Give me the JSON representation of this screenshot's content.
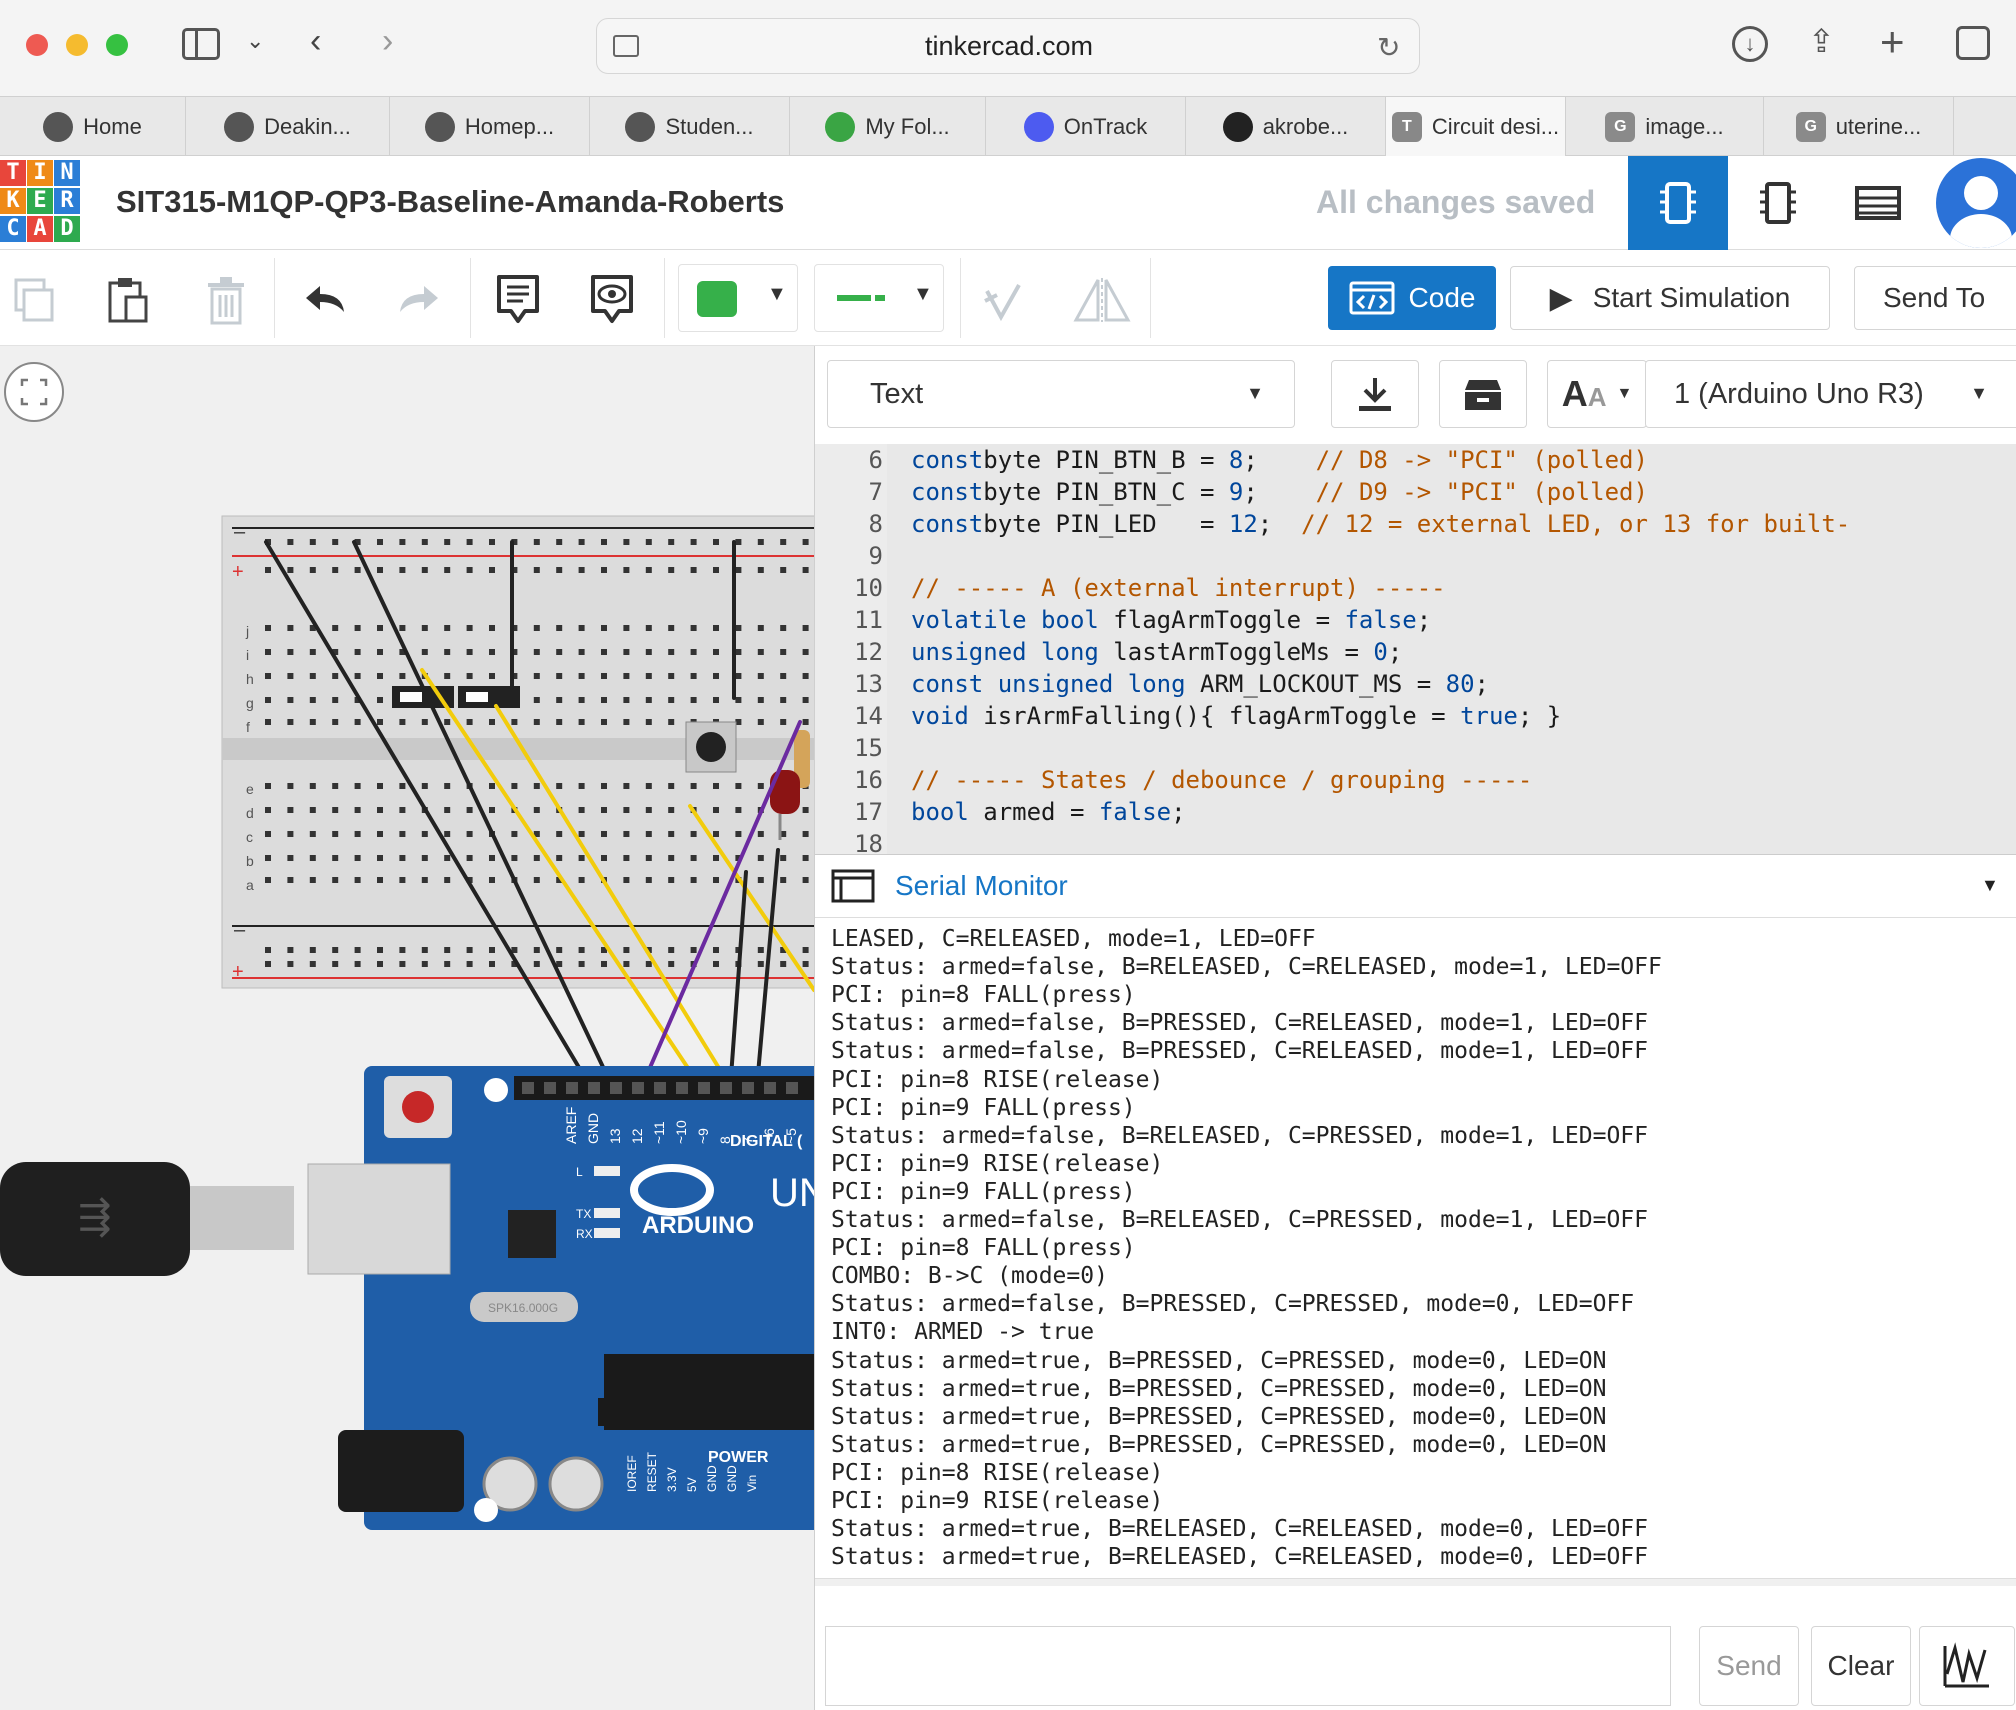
{
  "browser": {
    "url": "tinkercad.com",
    "tabs": [
      {
        "label": "Home",
        "icon": "brand-icon",
        "color": "#555555"
      },
      {
        "label": "Deakin...",
        "icon": "brand-icon",
        "color": "#555555"
      },
      {
        "label": "Homep...",
        "icon": "brand-icon",
        "color": "#555555"
      },
      {
        "label": "Studen...",
        "icon": "brand-icon",
        "color": "#555555"
      },
      {
        "label": "My Fol...",
        "icon": "folder-icon",
        "color": "#3aa544"
      },
      {
        "label": "OnTrack",
        "icon": "ontrack-icon",
        "color": "#4d5bf0"
      },
      {
        "label": "akrobe...",
        "icon": "github-icon",
        "color": "#222222"
      },
      {
        "label": "Circuit desi...",
        "icon": "letter-t-icon",
        "color": "#888888",
        "letter": "T"
      },
      {
        "label": "image...",
        "icon": "letter-g-icon",
        "color": "#8a8a8a",
        "letter": "G"
      },
      {
        "label": "uterine...",
        "icon": "letter-g-icon",
        "color": "#8a8a8a",
        "letter": "G"
      }
    ]
  },
  "app": {
    "logo_letters": [
      "T",
      "I",
      "N",
      "K",
      "E",
      "R",
      "C",
      "A",
      "D"
    ],
    "logo_colors": [
      "#e8463b",
      "#ef8a17",
      "#2b7ed6",
      "#ef8a17",
      "#2eaa4f",
      "#2b7ed6",
      "#2b7ed6",
      "#e8463b",
      "#2eaa4f"
    ],
    "project_title": "SIT315-M1QP-QP3-Baseline-Amanda-Roberts",
    "save_status": "All changes saved",
    "accent": "#1676c6"
  },
  "toolbar": {
    "code_label": "Code",
    "simulate_label": "Start Simulation",
    "send_to_label": "Send To",
    "fill_color": "#36b04a",
    "wire_color": "#36b04a"
  },
  "code_panel": {
    "mode_select": "Text",
    "board_select": "1 (Arduino Uno R3)",
    "lines": [
      {
        "n": "6",
        "segs": [
          [
            "kw",
            "const"
          ],
          [
            "",
            "byte PIN_BTN_B = "
          ],
          [
            "num",
            "8"
          ],
          [
            "",
            ";    "
          ],
          [
            "cm",
            "// D8 -> \"PCI\" (polled)"
          ]
        ]
      },
      {
        "n": "7",
        "segs": [
          [
            "kw",
            "const"
          ],
          [
            "",
            "byte PIN_BTN_C = "
          ],
          [
            "num",
            "9"
          ],
          [
            "",
            ";    "
          ],
          [
            "cm",
            "// D9 -> \"PCI\" (polled)"
          ]
        ]
      },
      {
        "n": "8",
        "segs": [
          [
            "kw",
            "const"
          ],
          [
            "",
            "byte PIN_LED   = "
          ],
          [
            "num",
            "12"
          ],
          [
            "",
            ";  "
          ],
          [
            "cm",
            "// 12 = external LED, or 13 for built-"
          ]
        ]
      },
      {
        "n": "9",
        "segs": []
      },
      {
        "n": "10",
        "segs": [
          [
            "cm",
            "// ----- A (external interrupt) -----"
          ]
        ]
      },
      {
        "n": "11",
        "segs": [
          [
            "kw",
            "volatile bool"
          ],
          [
            "",
            " flagArmToggle = "
          ],
          [
            "kw",
            "false"
          ],
          [
            "",
            ";"
          ]
        ]
      },
      {
        "n": "12",
        "segs": [
          [
            "kw",
            "unsigned long"
          ],
          [
            "",
            " lastArmToggleMs = "
          ],
          [
            "num",
            "0"
          ],
          [
            "",
            ";"
          ]
        ]
      },
      {
        "n": "13",
        "segs": [
          [
            "kw",
            "const unsigned long"
          ],
          [
            "",
            " ARM_LOCKOUT_MS = "
          ],
          [
            "num",
            "80"
          ],
          [
            "",
            ";"
          ]
        ]
      },
      {
        "n": "14",
        "segs": [
          [
            "kw",
            "void"
          ],
          [
            "",
            " isrArmFalling(){ flagArmToggle = "
          ],
          [
            "kw",
            "true"
          ],
          [
            "",
            "; }"
          ]
        ]
      },
      {
        "n": "15",
        "segs": []
      },
      {
        "n": "16",
        "segs": [
          [
            "cm",
            "// ----- States / debounce / grouping -----"
          ]
        ]
      },
      {
        "n": "17",
        "segs": [
          [
            "kw",
            "bool"
          ],
          [
            "",
            " armed = "
          ],
          [
            "kw",
            "false"
          ],
          [
            "",
            ";"
          ]
        ]
      },
      {
        "n": "18",
        "segs": []
      }
    ]
  },
  "serial_monitor": {
    "title": "Serial Monitor",
    "send_label": "Send",
    "clear_label": "Clear",
    "lines": [
      "LEASED, C=RELEASED, mode=1, LED=OFF",
      "Status: armed=false, B=RELEASED, C=RELEASED, mode=1, LED=OFF",
      "PCI: pin=8 FALL(press)",
      "Status: armed=false, B=PRESSED, C=RELEASED, mode=1, LED=OFF",
      "Status: armed=false, B=PRESSED, C=RELEASED, mode=1, LED=OFF",
      "PCI: pin=8 RISE(release)",
      "PCI: pin=9 FALL(press)",
      "Status: armed=false, B=RELEASED, C=PRESSED, mode=1, LED=OFF",
      "PCI: pin=9 RISE(release)",
      "PCI: pin=9 FALL(press)",
      "Status: armed=false, B=RELEASED, C=PRESSED, mode=1, LED=OFF",
      "PCI: pin=8 FALL(press)",
      "COMBO: B->C (mode=0)",
      "Status: armed=false, B=PRESSED, C=PRESSED, mode=0, LED=OFF",
      "INT0: ARMED -> true",
      "Status: armed=true, B=PRESSED, C=PRESSED, mode=0, LED=ON",
      "Status: armed=true, B=PRESSED, C=PRESSED, mode=0, LED=ON",
      "Status: armed=true, B=PRESSED, C=PRESSED, mode=0, LED=ON",
      "Status: armed=true, B=PRESSED, C=PRESSED, mode=0, LED=ON",
      "PCI: pin=8 RISE(release)",
      "PCI: pin=9 RISE(release)",
      "Status: armed=true, B=RELEASED, C=RELEASED, mode=0, LED=OFF",
      "Status: armed=true, B=RELEASED, C=RELEASED, mode=0, LED=OFF"
    ]
  },
  "circuit": {
    "board_name": "ARDUINO",
    "board_model": "UN",
    "digital_label": "DIGITAL (",
    "power_label": "POWER",
    "crystal_label": "SPK16.000G",
    "pin_labels": [
      "AREF",
      "GND",
      "13",
      "12",
      "~11",
      "~10",
      "~9",
      "8",
      "7",
      "~6",
      "~5"
    ],
    "power_pins": [
      "IOREF",
      "RESET",
      "3.3V",
      "5V",
      "GND",
      "GND",
      "Vin"
    ],
    "led_labels": [
      "L",
      "TX",
      "RX"
    ],
    "row_letters_top": [
      "j",
      "i",
      "h",
      "g",
      "f"
    ],
    "row_letters_bottom": [
      "e",
      "d",
      "c",
      "b",
      "a"
    ],
    "rail_minus": "–",
    "rail_plus": "+",
    "wire_colors": {
      "black": "#222222",
      "yellow": "#f2cc0c",
      "purple": "#6b2aa0"
    }
  }
}
